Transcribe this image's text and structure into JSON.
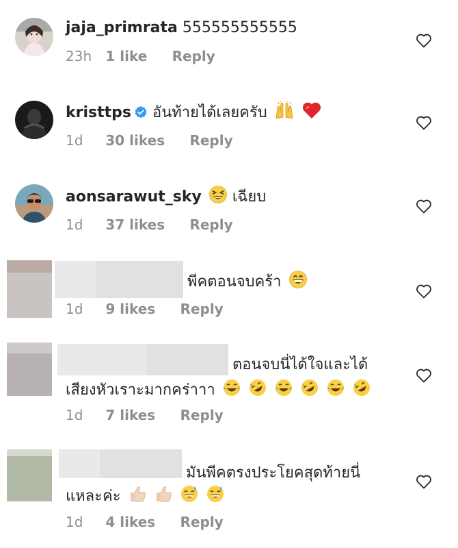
{
  "comments": [
    {
      "username": "jaja_primrata",
      "text": "555555555555",
      "time": "23h",
      "likes": "1 like",
      "reply": "Reply",
      "avatar": "avatar-woman-icon",
      "emojis": []
    },
    {
      "username": "kristtps",
      "verified": true,
      "text": "อันท้ายได้เลยครับ",
      "time": "1d",
      "likes": "30 likes",
      "reply": "Reply",
      "avatar": "avatar-man-dark-icon",
      "emojis": [
        "raising-hands-icon",
        "red-heart-icon"
      ]
    },
    {
      "username": "aonsarawut_sky",
      "text": "เฉียบ",
      "time": "1d",
      "likes": "37 likes",
      "reply": "Reply",
      "avatar": "avatar-man-sunglasses-icon",
      "emojis_before": [
        "laughing-squint-emoji-icon"
      ]
    },
    {
      "username": "",
      "text": "พีคตอนจบคร้า",
      "time": "1d",
      "likes": "9 likes",
      "reply": "Reply",
      "avatar": "blurred-avatar",
      "emojis": [
        "grinning-emoji-icon"
      ]
    },
    {
      "username": "",
      "text_line1": "ตอนจบนี่ได้ใจและได้",
      "text_line2": "เสียงหัวเราะมากคร่าาา",
      "time": "1d",
      "likes": "7 likes",
      "reply": "Reply",
      "avatar": "blurred-avatar",
      "emojis": [
        "joy-emoji-icon",
        "rofl-emoji-icon",
        "joy-emoji-icon",
        "rofl-emoji-icon",
        "joy-emoji-icon",
        "rofl-emoji-icon"
      ]
    },
    {
      "username": "",
      "text_line1": "มันพีคตรงประโยคสุดท้ายนี่",
      "text_line2": "แหละค่ะ",
      "time": "1d",
      "likes": "4 likes",
      "reply": "Reply",
      "avatar": "blurred-avatar",
      "emojis": [
        "thumbs-up-icon",
        "thumbs-up-icon",
        "sweat-smile-emoji-icon",
        "sweat-smile-emoji-icon"
      ]
    }
  ],
  "colors": {
    "text": "#262626",
    "meta": "#8e8e8e",
    "verified": "#3897f0",
    "heart": "#262626"
  }
}
